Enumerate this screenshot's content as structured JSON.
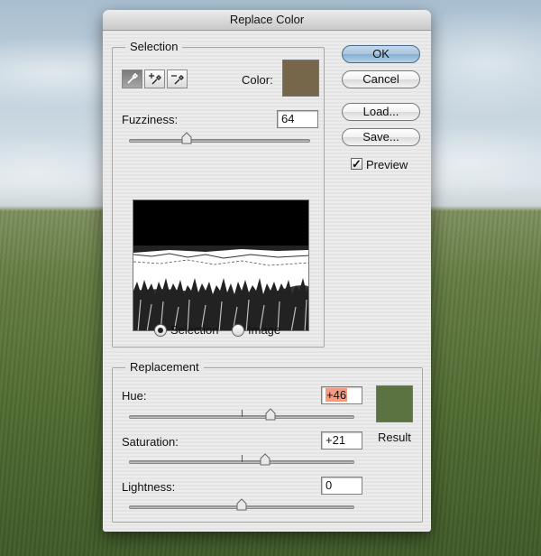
{
  "dialog": {
    "title": "Replace Color"
  },
  "selection": {
    "title": "Selection",
    "color_label": "Color:",
    "color_value": "#76664a",
    "tools": [
      "eyedropper-icon",
      "eyedropper-plus-icon",
      "eyedropper-minus-icon"
    ],
    "fuzziness_label": "Fuzziness:",
    "fuzziness_value": "64",
    "fuzziness_level": 64,
    "fuzziness_max": 200,
    "mode_selection_label": "Selection",
    "mode_image_label": "Image",
    "mode_selected": "Selection"
  },
  "replacement": {
    "title": "Replacement",
    "hue_label": "Hue:",
    "hue_value": "+46",
    "hue_level": 46,
    "saturation_label": "Saturation:",
    "saturation_value": "+21",
    "saturation_level": 21,
    "lightness_label": "Lightness:",
    "lightness_value": "0",
    "lightness_level": 0,
    "result_label": "Result",
    "result_color": "#5b7340"
  },
  "buttons": {
    "ok": "OK",
    "cancel": "Cancel",
    "load": "Load...",
    "save": "Save..."
  },
  "preview": {
    "label": "Preview",
    "checked": true
  }
}
